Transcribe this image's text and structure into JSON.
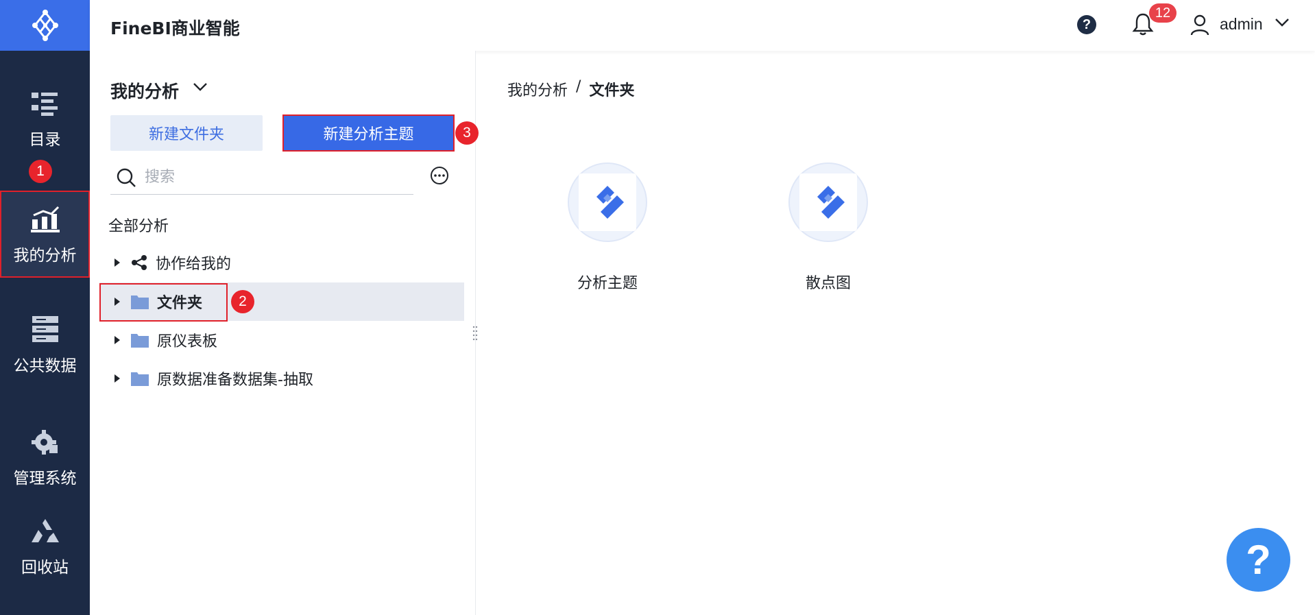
{
  "app": {
    "title": "FineBI商业智能"
  },
  "topbar": {
    "notification_count": "12",
    "user_name": "admin"
  },
  "nav": {
    "items": [
      {
        "label": "目录",
        "icon": "catalog-icon"
      },
      {
        "label": "我的分析",
        "icon": "analysis-chart-icon",
        "active": true
      },
      {
        "label": "公共数据",
        "icon": "database-icon"
      },
      {
        "label": "管理系统",
        "icon": "gear-icon"
      },
      {
        "label": "回收站",
        "icon": "recycle-icon"
      }
    ]
  },
  "panel": {
    "title": "我的分析",
    "new_folder_label": "新建文件夹",
    "new_subject_label": "新建分析主题",
    "search_placeholder": "搜索",
    "all_label": "全部分析",
    "tree": [
      {
        "label": "协作给我的",
        "icon": "share-icon"
      },
      {
        "label": "文件夹",
        "icon": "folder-icon",
        "selected": true
      },
      {
        "label": "原仪表板",
        "icon": "folder-icon"
      },
      {
        "label": "原数据准备数据集-抽取",
        "icon": "folder-icon"
      }
    ]
  },
  "main": {
    "breadcrumb": {
      "root": "我的分析",
      "separator": "/",
      "current": "文件夹"
    },
    "items": [
      {
        "label": "分析主题",
        "icon": "analysis-subject-icon"
      },
      {
        "label": "散点图",
        "icon": "analysis-subject-icon"
      }
    ]
  },
  "annotations": {
    "step1": "1",
    "step2": "2",
    "step3": "3"
  },
  "colors": {
    "nav_bg": "#1c2a45",
    "logo_bg": "#3a6ee8",
    "primary": "#3769e6",
    "highlight": "#e0202a"
  }
}
